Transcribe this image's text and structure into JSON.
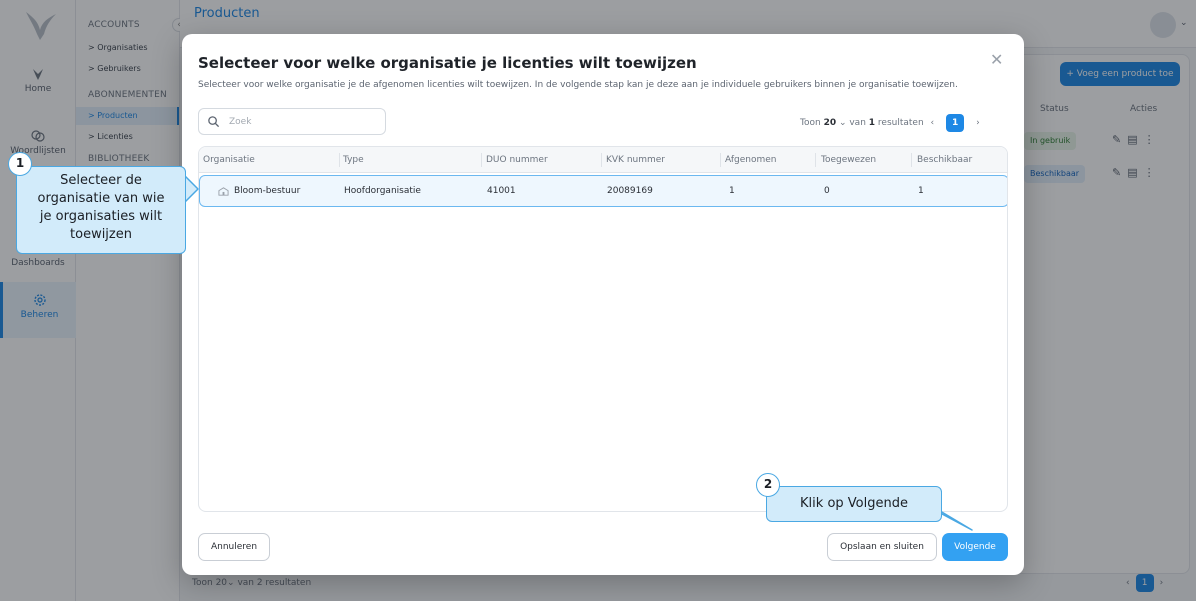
{
  "app": {
    "page_title": "Producten",
    "rail": {
      "home_label": "Home",
      "lists_label": "Woordlijsten",
      "dashboards_label": "Dashboards",
      "beheren_label": "Beheren"
    },
    "subnav": {
      "accounts_head": "ACCOUNTS",
      "organisaties": "> Organisaties",
      "gebruikers": "> Gebruikers",
      "abonnementen_head": "ABONNEMENTEN",
      "producten": "> Producten",
      "licenties": "> Licenties",
      "bibliotheek_head": "BIBLIOTHEEK"
    },
    "add_product_label": "+ Voeg een product toe",
    "bg_table": {
      "status_header": "Status",
      "actions_header": "Acties",
      "status_1": "In gebruik",
      "status_2": "Beschikbaar"
    },
    "footer": {
      "prefix": "Toon",
      "page_size": "20",
      "suffix": "van 2 resultaten",
      "page": "1"
    }
  },
  "modal": {
    "title": "Selecteer voor welke organisatie je licenties wilt toewijzen",
    "subtitle": "Selecteer voor welke organisatie je de afgenomen licenties wilt toewijzen. In de volgende stap kan je deze aan je individuele gebruikers binnen je organisatie toewijzen.",
    "search_placeholder": "Zoek",
    "pager": {
      "show": "Toon",
      "page_size": "20",
      "of": "van",
      "count": "1",
      "results": "resultaten",
      "page": "1"
    },
    "columns": [
      "Organisatie",
      "Type",
      "DUO nummer",
      "KVK nummer",
      "Afgenomen",
      "Toegewezen",
      "Beschikbaar"
    ],
    "rows": [
      {
        "organisatie": "Bloom-bestuur",
        "type": "Hoofdorganisatie",
        "duo": "41001",
        "kvk": "20089169",
        "afgenomen": "1",
        "toegewezen": "0",
        "beschikbaar": "1"
      }
    ],
    "cancel_label": "Annuleren",
    "save_close_label": "Opslaan en sluiten",
    "next_label": "Volgende"
  },
  "callouts": {
    "step1_number": "1",
    "step1_text_line1": "Selecteer de",
    "step1_text_line2": "organisatie van wie",
    "step1_text_line3": "je organisaties wilt",
    "step1_text_line4": "toewijzen",
    "step2_number": "2",
    "step2_text": "Klik op Volgende"
  },
  "colors": {
    "accent": "#1e88e5",
    "primary_button": "#33a1f2",
    "callout_fill": "#d2ebfa",
    "callout_border": "#4aa8e3",
    "status_in_use": "#e8f5e9",
    "status_available": "#e3f0fb"
  }
}
